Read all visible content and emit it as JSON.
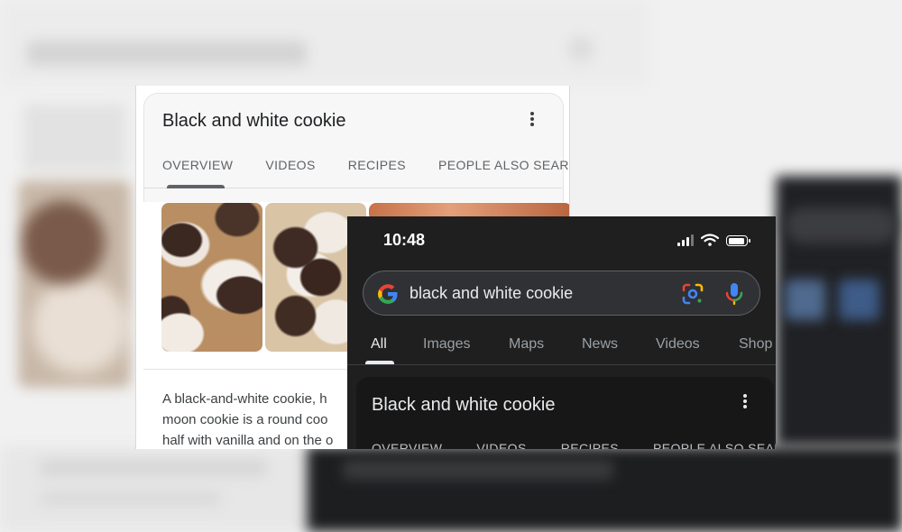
{
  "light_panel": {
    "card_title": "Black and white cookie",
    "tabs": [
      "OVERVIEW",
      "VIDEOS",
      "RECIPES",
      "PEOPLE ALSO SEAR"
    ],
    "active_tab": "OVERVIEW",
    "description": "A black-and-white cookie, h\nmoon cookie is a round coo\nhalf with vanilla and on the o"
  },
  "phone": {
    "status_time": "10:48",
    "search_query": "black and white cookie",
    "result_tabs": [
      "All",
      "Images",
      "Maps",
      "News",
      "Videos",
      "Shop"
    ],
    "active_result_tab": "All",
    "card_title": "Black and white cookie",
    "card_tabs": [
      "OVERVIEW",
      "VIDEOS",
      "RECIPES",
      "PEOPLE ALSO SEAR"
    ]
  },
  "colors": {
    "google_blue": "#4285F4",
    "google_red": "#EA4335",
    "google_yellow": "#FBBC05",
    "google_green": "#34A853",
    "dark_background": "#1f1f1f",
    "light_background": "#ffffff"
  },
  "icons": {
    "more_menu": "more-vert-icon",
    "google": "google-logo-icon",
    "lens": "google-lens-icon",
    "mic": "microphone-icon",
    "signal": "cellular-signal-icon",
    "wifi": "wifi-icon",
    "battery": "battery-icon"
  }
}
